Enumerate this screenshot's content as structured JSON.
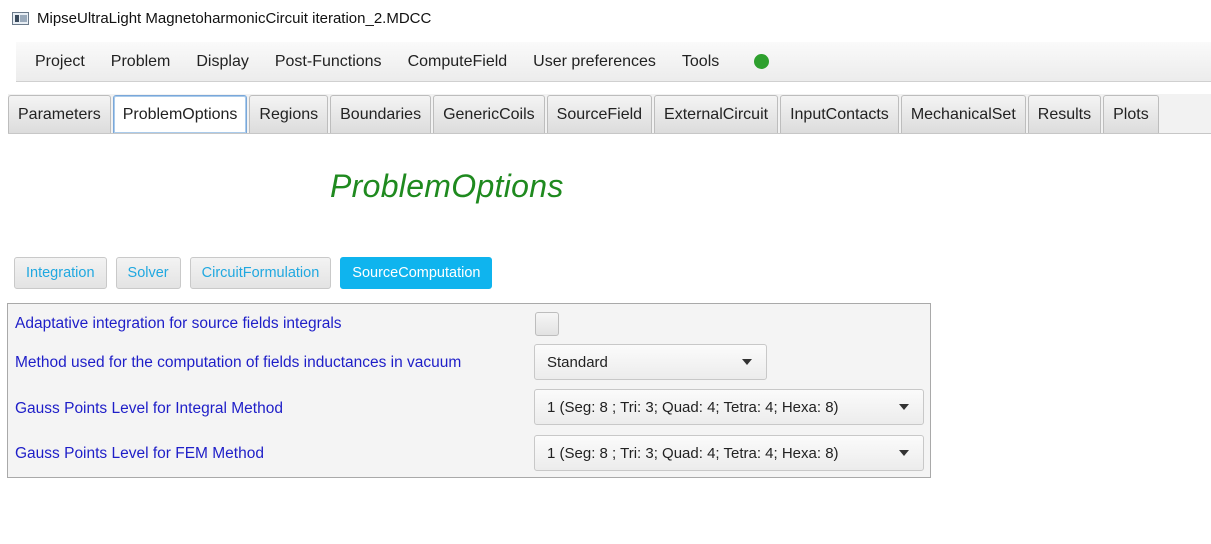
{
  "window": {
    "title": "MipseUltraLight MagnetoharmonicCircuit iteration_2.MDCC"
  },
  "menu": [
    "Project",
    "Problem",
    "Display",
    "Post-Functions",
    "ComputeField",
    "User preferences",
    "Tools"
  ],
  "status": {
    "color": "#2ea02e"
  },
  "tabs": [
    "Parameters",
    "ProblemOptions",
    "Regions",
    "Boundaries",
    "GenericCoils",
    "SourceField",
    "ExternalCircuit",
    "InputContacts",
    "MechanicalSet",
    "Results",
    "Plots"
  ],
  "active_tab": "ProblemOptions",
  "page": {
    "title": "ProblemOptions"
  },
  "subtabs": [
    "Integration",
    "Solver",
    "CircuitFormulation",
    "SourceComputation"
  ],
  "active_subtab": "SourceComputation",
  "options": {
    "adaptative": {
      "label": "Adaptative integration for source fields integrals",
      "checked": false
    },
    "method": {
      "label": "Method used for the computation of fields inductances in vacuum",
      "value": "Standard"
    },
    "gauss_integral": {
      "label": "Gauss Points Level for Integral Method",
      "value": "1 (Seg: 8 ; Tri: 3; Quad: 4; Tetra: 4; Hexa:  8)"
    },
    "gauss_fem": {
      "label": "Gauss Points Level for FEM Method",
      "value": "1 (Seg: 8 ; Tri: 3; Quad: 4; Tetra: 4; Hexa:  8)"
    }
  },
  "colors": {
    "title_green": "#1f8a1f",
    "label_blue": "#1e1ec8",
    "subtab_text": "#20a8e0",
    "subtab_active_bg": "#0fb4ee"
  }
}
